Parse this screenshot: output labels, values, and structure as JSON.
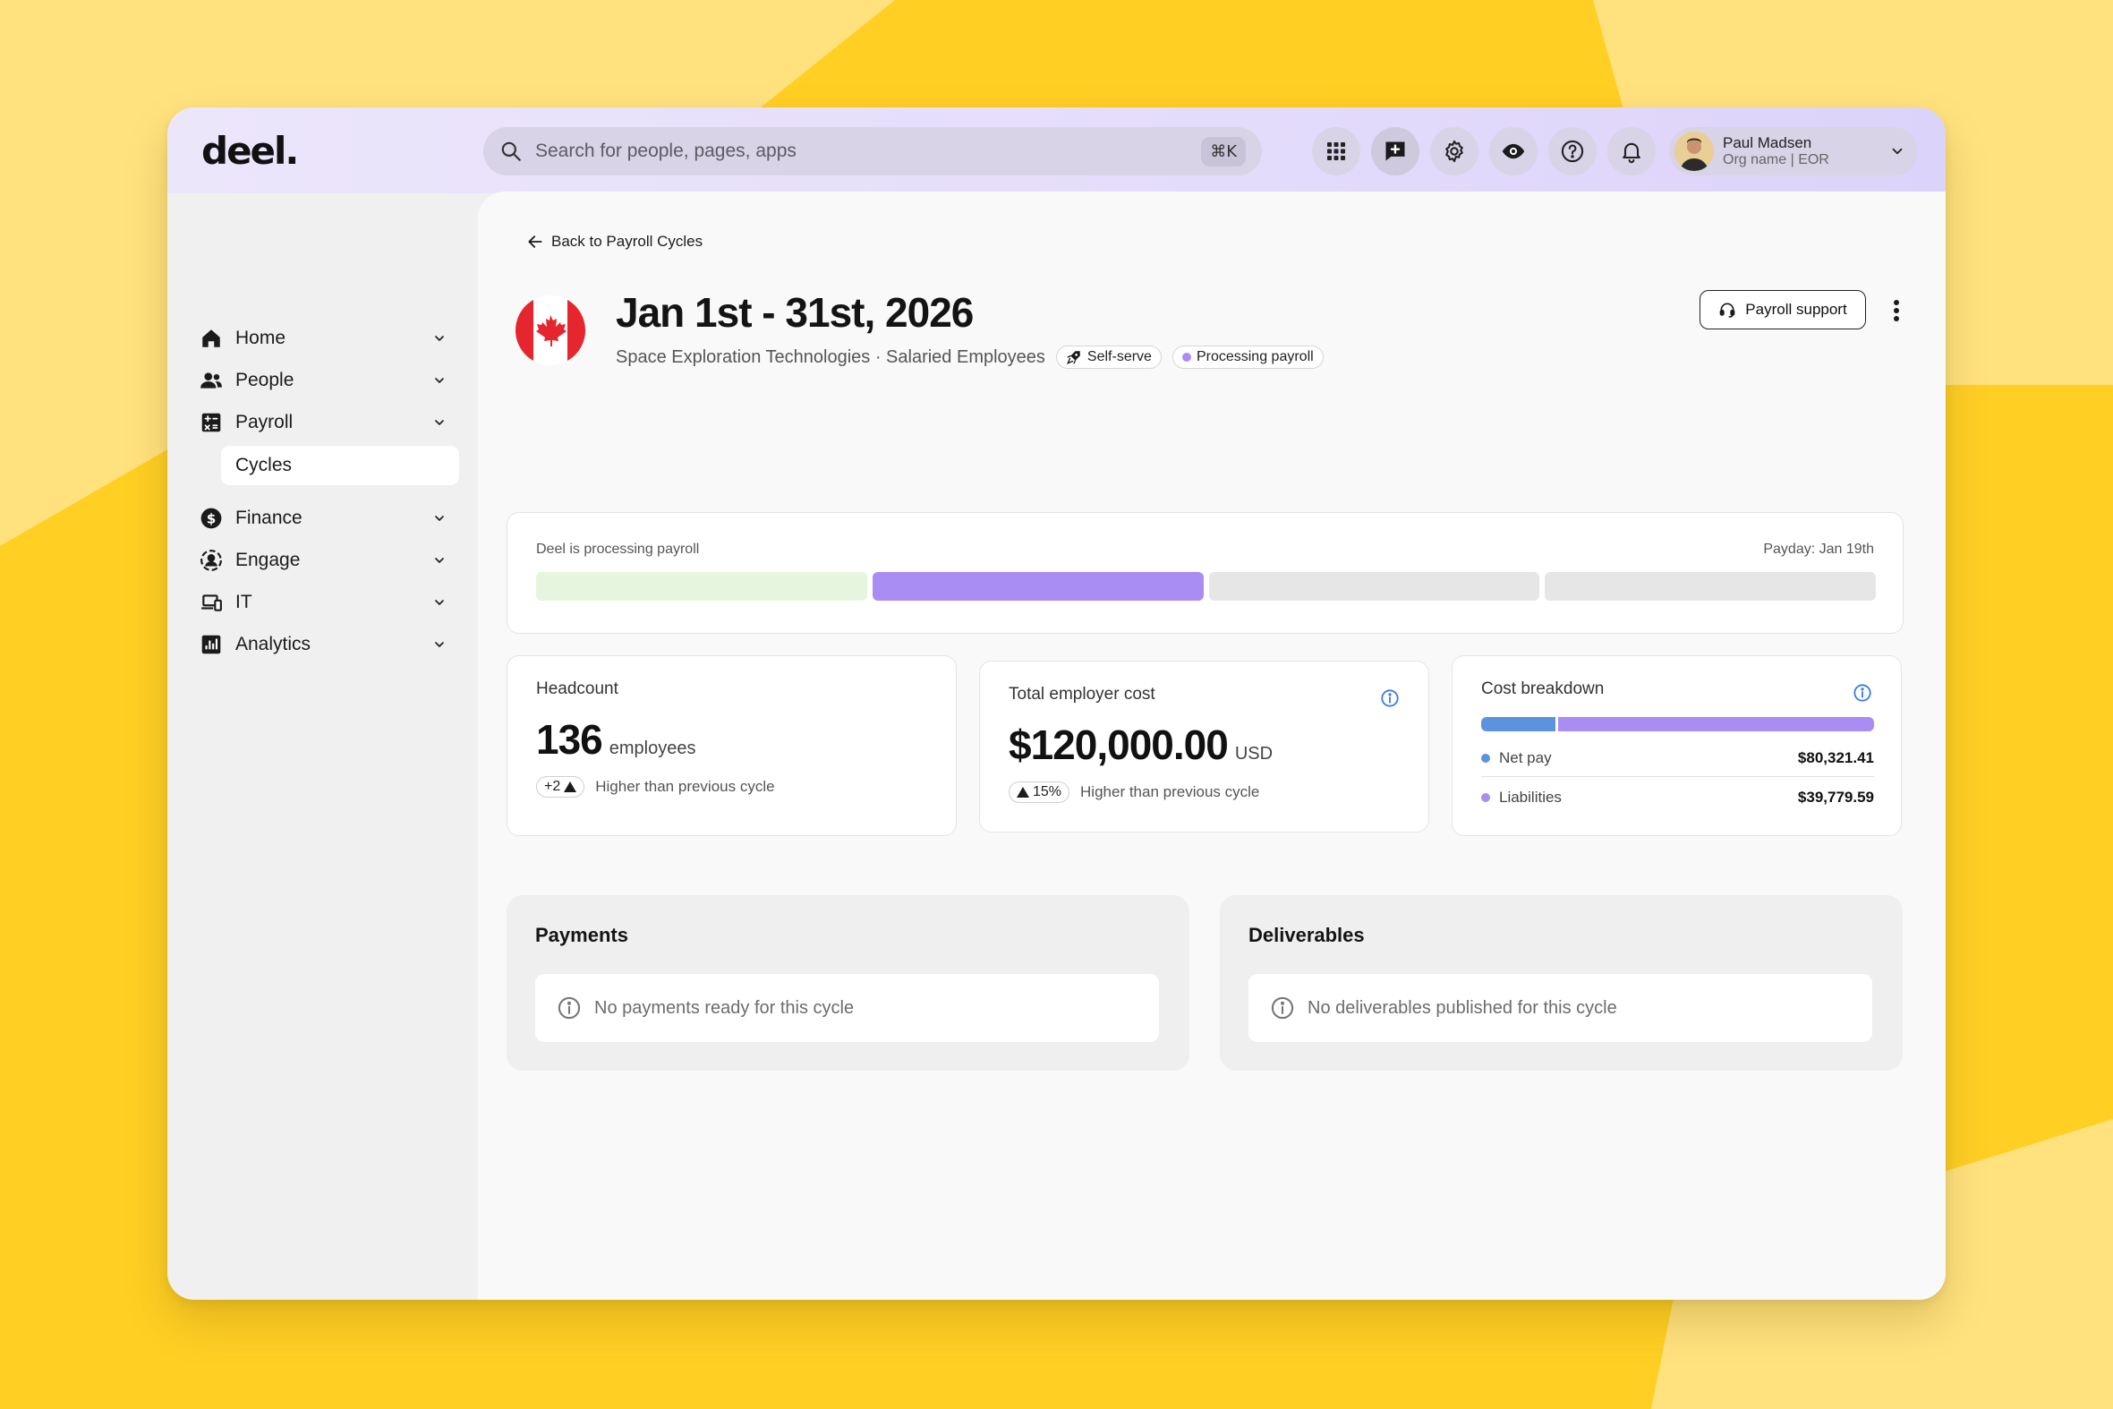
{
  "brand": {
    "logo_text": "deel.",
    "bg_color": "#ffe27e",
    "accent_yellow": "#ffcf24"
  },
  "header": {
    "search": {
      "placeholder": "Search for people, pages, apps",
      "shortcut": "⌘K"
    },
    "icons": [
      "apps-grid-icon",
      "chat-add-icon",
      "gear-icon",
      "eye-icon",
      "help-icon",
      "bell-icon"
    ],
    "user": {
      "name": "Paul Madsen",
      "org": "Org name | EOR"
    }
  },
  "sidebar": {
    "items": [
      {
        "label": "Home",
        "icon": "home-icon"
      },
      {
        "label": "People",
        "icon": "people-icon"
      },
      {
        "label": "Payroll",
        "icon": "payroll-icon",
        "expanded": true,
        "children": [
          {
            "label": "Cycles",
            "selected": true
          }
        ]
      },
      {
        "label": "Finance",
        "icon": "dollar-icon"
      },
      {
        "label": "Engage",
        "icon": "engage-icon"
      },
      {
        "label": "IT",
        "icon": "devices-icon"
      },
      {
        "label": "Analytics",
        "icon": "analytics-icon"
      }
    ]
  },
  "page": {
    "back_label": "Back to Payroll Cycles",
    "title": "Jan 1st - 31st, 2026",
    "company": "Space Exploration Technologies · Salaried Employees",
    "chips": {
      "self_serve": "Self-serve",
      "status": "Processing payroll"
    },
    "support_button": "Payroll support"
  },
  "progress": {
    "label": "Deel is processing payroll",
    "payday": "Payday: Jan 19th",
    "segments": [
      {
        "state": "done",
        "color": "#e6f5dd"
      },
      {
        "state": "current",
        "color": "#a98df2"
      },
      {
        "state": "pending",
        "color": "#e6e6e6"
      },
      {
        "state": "pending",
        "color": "#e6e6e6"
      }
    ]
  },
  "stats": {
    "headcount": {
      "label": "Headcount",
      "value": "136",
      "unit": "employees",
      "delta": "+2",
      "note": "Higher than previous cycle"
    },
    "employer_cost": {
      "label": "Total employer cost",
      "value": "$120,000.00",
      "unit": "USD",
      "delta": "15%",
      "note": "Higher than previous cycle"
    },
    "breakdown": {
      "label": "Cost breakdown",
      "items": [
        {
          "name": "Net pay",
          "value": "$80,321.41",
          "color": "#5b93de",
          "share": 0.19
        },
        {
          "name": "Liabilities",
          "value": "$39,779.59",
          "color": "#a98df2",
          "share": 0.81
        }
      ]
    }
  },
  "panels": {
    "payments": {
      "title": "Payments",
      "empty": "No payments ready for this cycle"
    },
    "deliverables": {
      "title": "Deliverables",
      "empty": "No deliverables published for this cycle"
    }
  }
}
